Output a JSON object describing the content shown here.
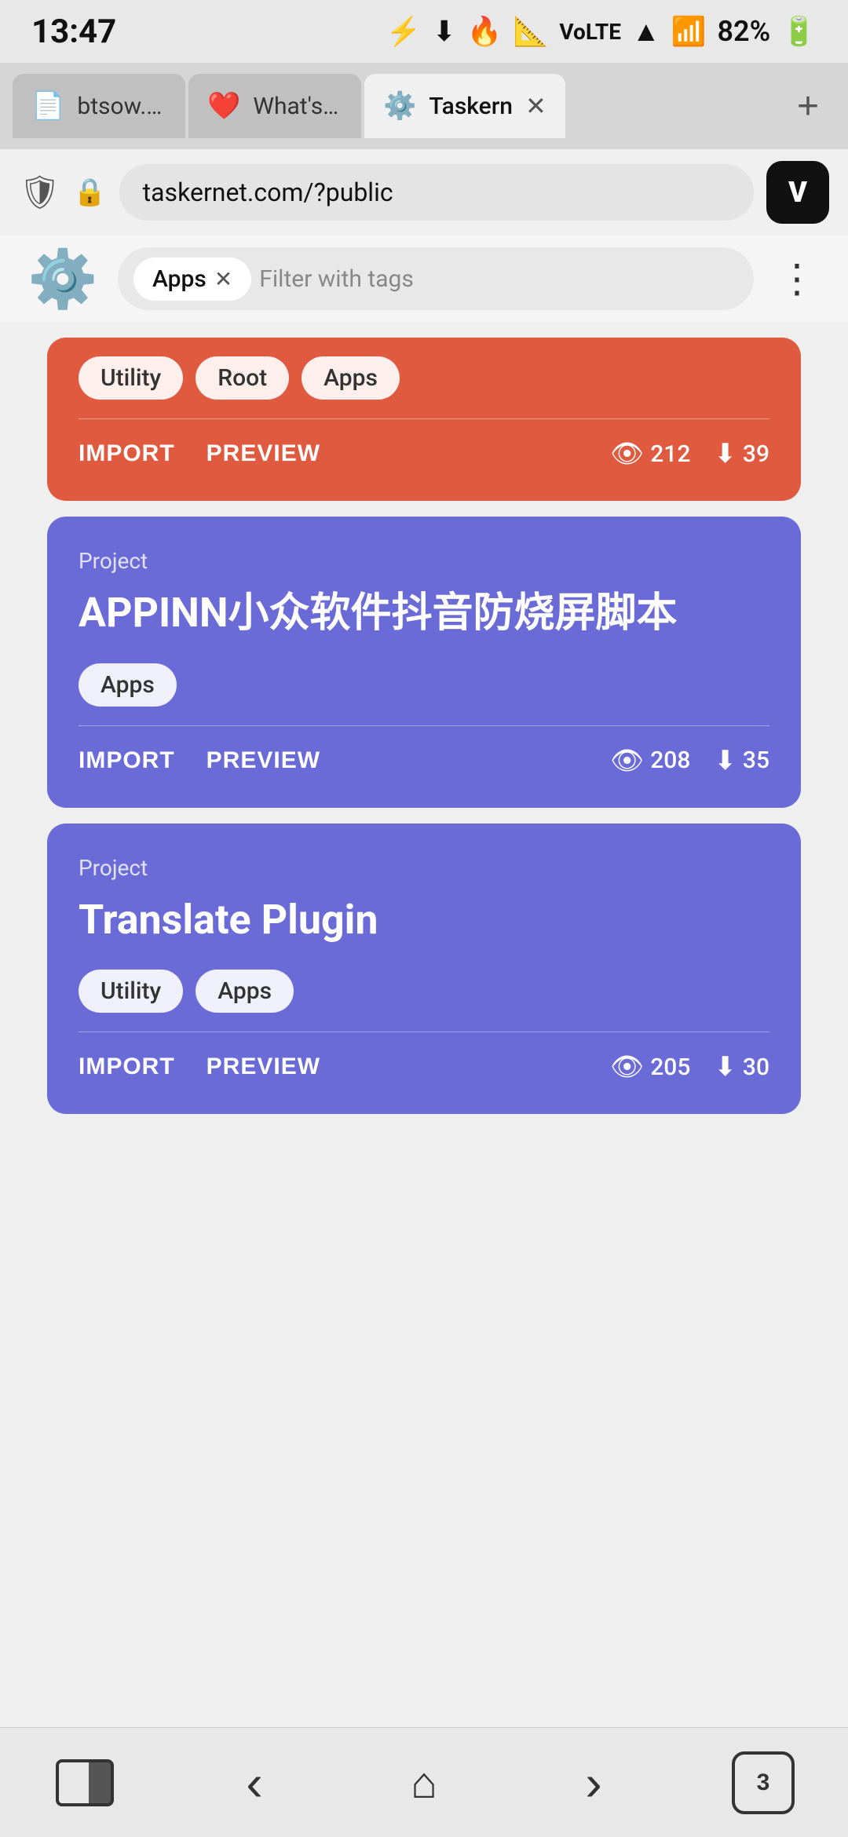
{
  "statusBar": {
    "time": "13:47",
    "icons": [
      "⚡",
      "⬇",
      "🔥",
      "📐"
    ],
    "signal": "4G",
    "battery": "82%"
  },
  "tabs": [
    {
      "id": "tab-btsow",
      "icon": "📄",
      "label": "btsow.one",
      "active": false
    },
    {
      "id": "tab-whatsnew",
      "icon": "❤️",
      "label": "What's ne",
      "active": false
    },
    {
      "id": "tab-taskernet",
      "icon": "⚙️",
      "label": "Taskern",
      "active": true
    }
  ],
  "urlBar": {
    "url": "taskernet.com/?public",
    "shield": "🛡",
    "lock": "🔒"
  },
  "filterBar": {
    "appLogo": "⚙️",
    "activeTag": "Apps",
    "placeholder": "Filter with tags",
    "moreIcon": "⋮"
  },
  "partialCard": {
    "tags": [
      "Utility",
      "Root",
      "Apps"
    ],
    "actions": {
      "import": "IMPORT",
      "preview": "PREVIEW"
    },
    "stats": {
      "views": "212",
      "downloads": "39"
    }
  },
  "cards": [
    {
      "id": "card-appinn",
      "color": "purple",
      "type": "Project",
      "title": "APPINN小众软件抖音防烧屏脚本",
      "tags": [
        "Apps"
      ],
      "actions": {
        "import": "IMPORT",
        "preview": "PREVIEW"
      },
      "stats": {
        "views": "208",
        "downloads": "35"
      }
    },
    {
      "id": "card-translate",
      "color": "purple",
      "type": "Project",
      "title": "Translate Plugin",
      "tags": [
        "Utility",
        "Apps"
      ],
      "actions": {
        "import": "IMPORT",
        "preview": "PREVIEW"
      },
      "stats": {
        "views": "205",
        "downloads": "30"
      }
    }
  ],
  "bottomNav": {
    "screenIcon": "screen",
    "backIcon": "‹",
    "homeIcon": "⌂",
    "forwardIcon": "›",
    "tabsCount": "3"
  }
}
